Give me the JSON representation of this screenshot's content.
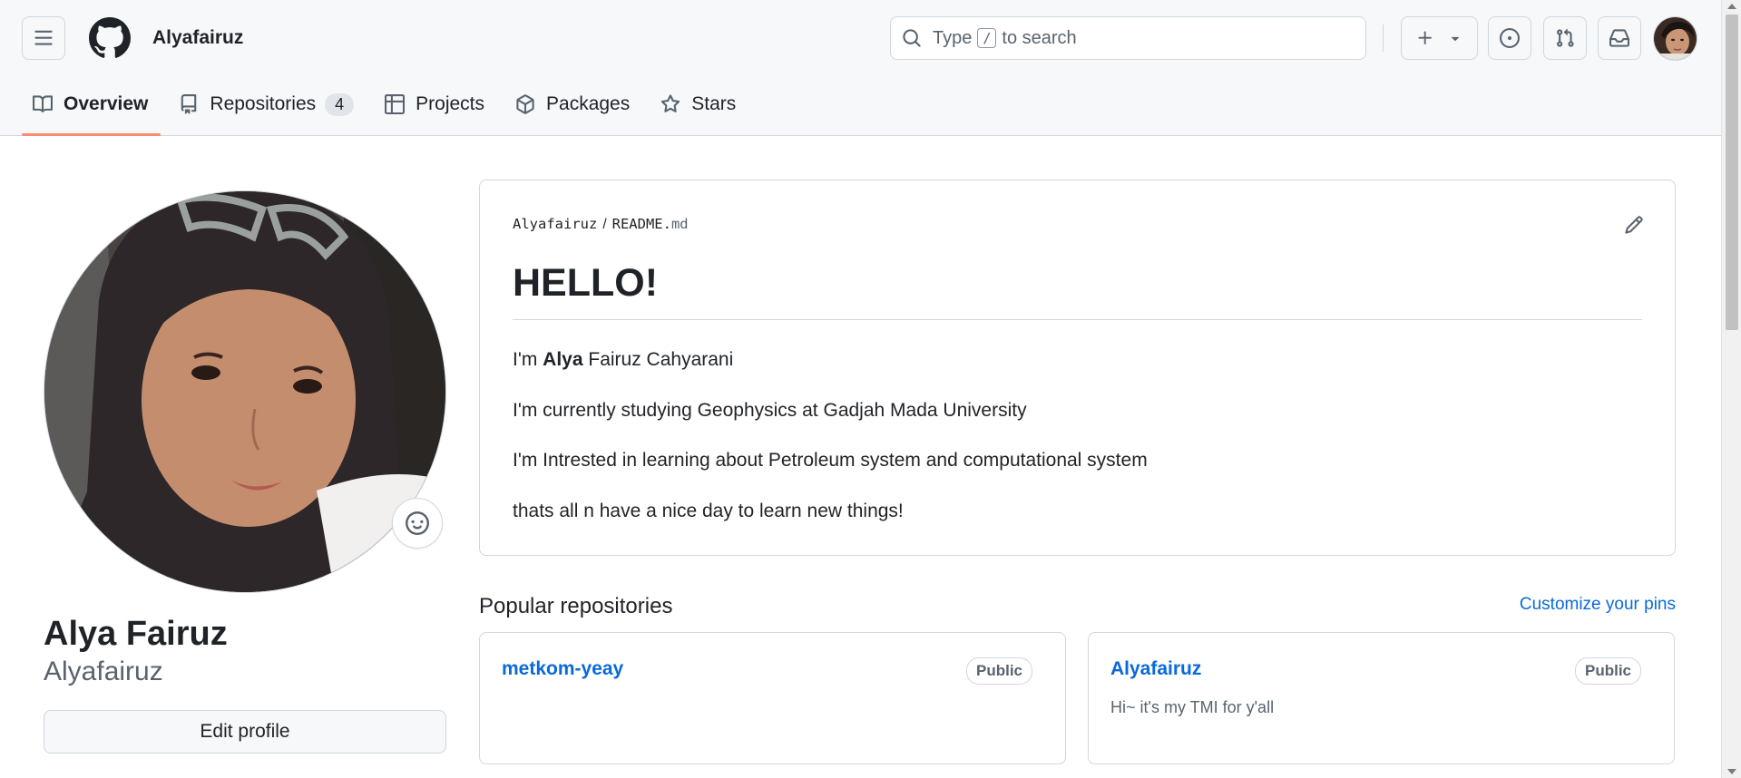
{
  "header": {
    "username": "Alyafairuz",
    "search_prefix": "Type",
    "search_key": "/",
    "search_suffix": "to search",
    "icons": {
      "menu": "hamburger-icon",
      "logo": "github-logo-icon",
      "search": "search-icon",
      "create": "plus-icon",
      "create_dropdown": "triangle-down-icon",
      "issues": "issue-opened-icon",
      "pull_requests": "git-pull-request-icon",
      "inbox": "inbox-icon"
    }
  },
  "tabs": [
    {
      "label": "Overview",
      "icon": "book-icon",
      "active": true
    },
    {
      "label": "Repositories",
      "icon": "repo-icon",
      "count": "4"
    },
    {
      "label": "Projects",
      "icon": "table-icon"
    },
    {
      "label": "Packages",
      "icon": "package-icon"
    },
    {
      "label": "Stars",
      "icon": "star-icon"
    }
  ],
  "profile": {
    "full_name": "Alya Fairuz",
    "login": "Alyafairuz",
    "edit_label": "Edit profile",
    "status_icon": "smiley-icon"
  },
  "readme": {
    "owner": "Alyafairuz",
    "separator": "/",
    "file_base": "README.",
    "file_ext": "md",
    "heading": "HELLO!",
    "line1_pre": "I'm ",
    "line1_bold": "Alya",
    "line1_post": " Fairuz Cahyarani",
    "line2": "I'm currently studying Geophysics at Gadjah Mada University",
    "line3": "I'm Intrested in learning about Petroleum system and computational system",
    "line4": "thats all n have a nice day to learn new things!"
  },
  "popular": {
    "title": "Popular repositories",
    "customize_label": "Customize your pins",
    "repos": [
      {
        "name": "metkom-yeay",
        "visibility": "Public",
        "description": ""
      },
      {
        "name": "Alyafairuz",
        "visibility": "Public",
        "description": "Hi~ it's my TMI for y'all"
      }
    ]
  },
  "colors": {
    "accent_link": "#0969da",
    "tab_underline": "#fd8c73",
    "border": "#d0d7de",
    "header_bg": "#f6f8fa"
  }
}
